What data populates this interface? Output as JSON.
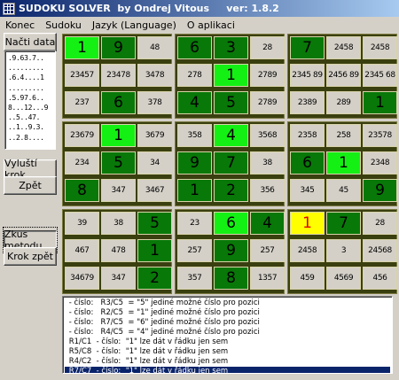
{
  "window": {
    "title": "SUDOKU SOLVER  by Ondrej Vitous     ver: 1.8.2"
  },
  "menu": [
    "Konec",
    "Sudoku",
    "Jazyk (Language)",
    "O aplikaci"
  ],
  "buttons": {
    "load": "Načti data",
    "solve_step": "Vyluští krok",
    "back": "Zpět",
    "try_method": "Zkus metodu",
    "step_back": "Krok zpět"
  },
  "puzzle_lines": [
    ".9.63.7..",
    ".........",
    ".6.4....1",
    ".........",
    ".5.97.6..",
    "8...12...9",
    "..5..47.",
    "..1..9.3.",
    "..2.8...."
  ],
  "board_cells": [
    [
      "1",
      "9",
      "48",
      "6",
      "3",
      "28",
      "7",
      "2458",
      "2458"
    ],
    [
      "23457",
      "23478",
      "3478",
      "278",
      "1",
      "2789",
      "2345 89",
      "2456 89",
      "2345 68"
    ],
    [
      "237",
      "6",
      "378",
      "4",
      "5",
      "2789",
      "2389",
      "289",
      "1"
    ],
    [
      "23679",
      "1",
      "3679",
      "358",
      "4",
      "3568",
      "2358",
      "258",
      "23578"
    ],
    [
      "234",
      "5",
      "34",
      "9",
      "7",
      "38",
      "6",
      "1",
      "2348"
    ],
    [
      "8",
      "347",
      "3467",
      "1",
      "2",
      "356",
      "345",
      "45",
      "9"
    ],
    [
      "39",
      "38",
      "5",
      "23",
      "6",
      "4",
      "1",
      "7",
      "28"
    ],
    [
      "467",
      "478",
      "1",
      "257",
      "9",
      "257",
      "2458",
      "3",
      "24568"
    ],
    [
      "34679",
      "347",
      "2",
      "357",
      "8",
      "1357",
      "459",
      "4569",
      "456"
    ]
  ],
  "cell_states": [
    [
      "solved",
      "given",
      "cand",
      "given",
      "given",
      "cand",
      "given",
      "cand",
      "cand"
    ],
    [
      "cand",
      "cand",
      "cand",
      "cand",
      "solved",
      "cand",
      "cand",
      "cand",
      "cand"
    ],
    [
      "cand",
      "given",
      "cand",
      "given",
      "given",
      "cand",
      "cand",
      "cand",
      "given"
    ],
    [
      "cand",
      "solved",
      "cand",
      "cand",
      "solved",
      "cand",
      "cand",
      "cand",
      "cand"
    ],
    [
      "cand",
      "given",
      "cand",
      "given",
      "given",
      "cand",
      "given",
      "solved",
      "cand"
    ],
    [
      "given",
      "cand",
      "cand",
      "given",
      "given",
      "cand",
      "cand",
      "cand",
      "given"
    ],
    [
      "cand",
      "cand",
      "given",
      "cand",
      "solved",
      "given",
      "selected",
      "given",
      "cand"
    ],
    [
      "cand",
      "cand",
      "given",
      "cand",
      "given",
      "cand",
      "cand",
      "cand",
      "cand"
    ],
    [
      "cand",
      "cand",
      "given",
      "cand",
      "given",
      "cand",
      "cand",
      "cand",
      "cand"
    ]
  ],
  "log": [
    " - číslo:   R3/C5  = \"5\" jediné možné číslo pro pozici",
    " - číslo:   R2/C5  = \"1\" jediné možné číslo pro pozici",
    " - číslo:   R7/C5  = \"6\" jediné možné číslo pro pozici",
    " - číslo:   R4/C5  = \"4\" jediné možné číslo pro pozici",
    " R1/C1  - číslo:  \"1\" lze dát v řádku jen sem",
    " R5/C8  - číslo:  \"1\" lze dát v řádku jen sem",
    " R4/C2  - číslo:  \"1\" lze dát v řádku jen sem",
    " R7/C7  - číslo:  \"1\" lze dát v řádku jen sem"
  ],
  "log_selected_index": 7,
  "colors": {
    "given": "#087808",
    "solved": "#14f014",
    "selected": "#ffff00",
    "selected_text": "#e00000",
    "candidate_bg": "#d4d0c8",
    "block_border": "#3a3f10",
    "titlebar_start": "#0a246a"
  }
}
